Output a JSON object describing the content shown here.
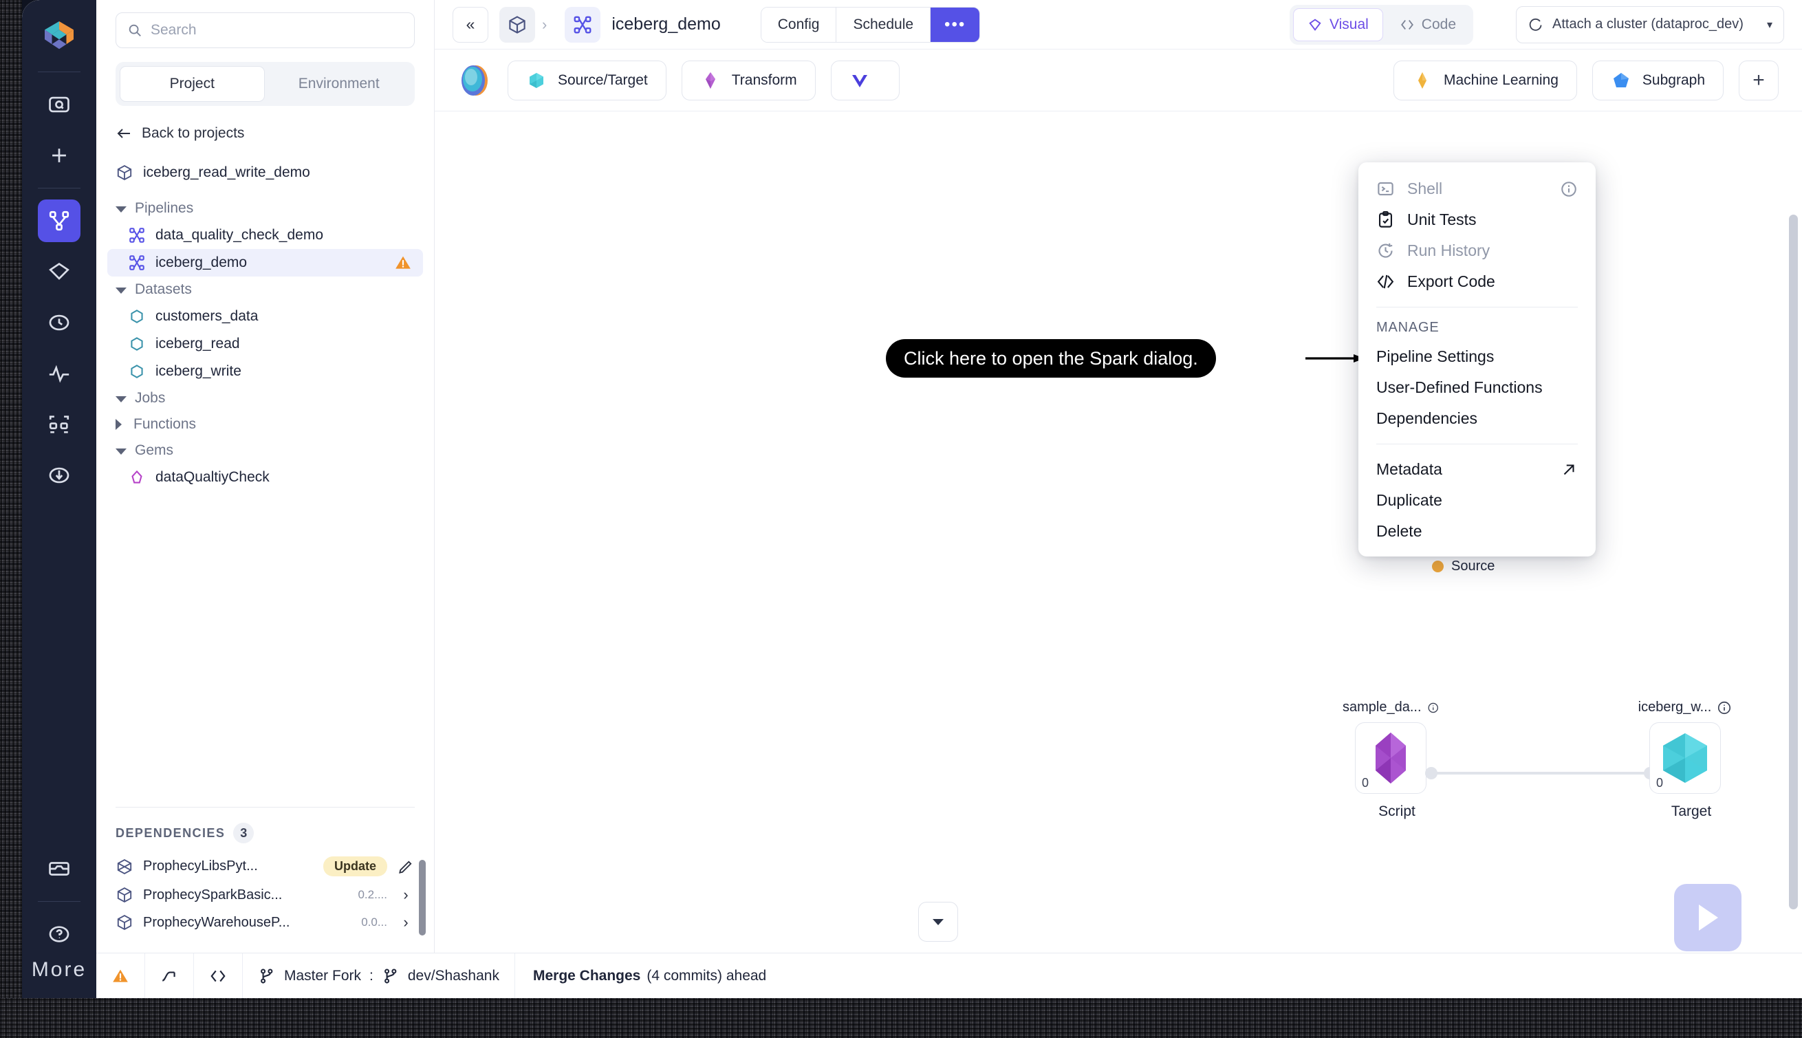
{
  "rail": {
    "logo": "prophecy-logo",
    "items": [
      {
        "name": "search-folder-icon",
        "label": "Search"
      },
      {
        "name": "plus-icon",
        "label": "Create"
      },
      {
        "name": "pipeline-graph-icon",
        "label": "Pipelines",
        "active": true
      },
      {
        "name": "gem-diamond-icon",
        "label": "Gems"
      },
      {
        "name": "clock-history-icon",
        "label": "History"
      },
      {
        "name": "pulse-activity-icon",
        "label": "Monitoring"
      },
      {
        "name": "lineage-nodes-icon",
        "label": "Lineage"
      },
      {
        "name": "download-circle-icon",
        "label": "Deploy"
      }
    ],
    "bottom": [
      {
        "name": "storage-icon",
        "label": "Storage"
      },
      {
        "name": "help-question-icon",
        "label": "Help"
      },
      {
        "name": "more-dots-icon",
        "label": "More"
      }
    ]
  },
  "panel": {
    "search": {
      "placeholder": "Search"
    },
    "tabs": [
      {
        "label": "Project",
        "selected": true
      },
      {
        "label": "Environment",
        "selected": false
      }
    ],
    "back_label": "Back to projects",
    "project_name": "iceberg_read_write_demo",
    "tree": [
      {
        "type": "group",
        "label": "Pipelines",
        "expanded": true
      },
      {
        "type": "item",
        "label": "data_quality_check_demo",
        "icon": "pipeline-graph-icon",
        "selected": false
      },
      {
        "type": "item",
        "label": "iceberg_demo",
        "icon": "pipeline-graph-icon",
        "selected": true,
        "badge": "warning"
      },
      {
        "type": "group",
        "label": "Datasets",
        "expanded": true
      },
      {
        "type": "item",
        "label": "customers_data",
        "icon": "dataset-hexagon-icon",
        "selected": false
      },
      {
        "type": "item",
        "label": "iceberg_read",
        "icon": "dataset-hexagon-icon",
        "selected": false
      },
      {
        "type": "item",
        "label": "iceberg_write",
        "icon": "dataset-hexagon-icon",
        "selected": false
      },
      {
        "type": "group",
        "label": "Jobs",
        "expanded": true
      },
      {
        "type": "group",
        "label": "Functions",
        "expanded": false
      },
      {
        "type": "group",
        "label": "Gems",
        "expanded": true
      },
      {
        "type": "item",
        "label": "dataQualtiyCheck",
        "icon": "gem-pentagon-icon",
        "selected": false
      }
    ],
    "dependencies": {
      "title": "DEPENDENCIES",
      "count": "3",
      "rows": [
        {
          "name": "ProphecyLibsPyt...",
          "pill": "Update",
          "trailing": "edit-pencil-icon",
          "version": ""
        },
        {
          "name": "ProphecySparkBasic...",
          "version": "0.2....",
          "trailing": "chevron-right-icon",
          "pill": ""
        },
        {
          "name": "ProphecyWarehouseP...",
          "version": "0.0...",
          "trailing": "chevron-right-icon",
          "pill": ""
        }
      ]
    }
  },
  "topbar": {
    "collapse_label": "«",
    "breadcrumb_project_icon": "cube-icon",
    "breadcrumb_sep": "›",
    "breadcrumb_pipeline_icon": "pipeline-graph-icon",
    "title": "iceberg_demo",
    "config_label": "Config",
    "schedule_label": "Schedule",
    "more_label": "•••",
    "view_toggle": [
      {
        "label": "Visual",
        "icon": "gem-diamond-icon",
        "selected": true
      },
      {
        "label": "Code",
        "icon": "code-brackets-icon",
        "selected": false
      }
    ],
    "cluster": {
      "label": "Attach a cluster (dataproc_dev)",
      "icon": "spinner-icon",
      "caret": "▾"
    }
  },
  "gembar": {
    "orb": "prophecy-orb-icon",
    "buttons": [
      {
        "label": "Source/Target",
        "icon": "hexagon-teal-icon"
      },
      {
        "label": "Transform",
        "icon": "diamond-purple-icon"
      },
      {
        "label": "",
        "icon": "chevron-indigo-icon"
      },
      {
        "label": "Machine Learning",
        "icon": "diamond-gold-icon"
      },
      {
        "label": "Subgraph",
        "icon": "pentagon-blue-icon"
      }
    ],
    "add_label": "+"
  },
  "menu": {
    "items": [
      {
        "label": "Shell",
        "icon": "terminal-icon",
        "disabled": true,
        "trailing": "info-icon"
      },
      {
        "label": "Unit Tests",
        "icon": "clipboard-check-icon",
        "disabled": false,
        "trailing": ""
      },
      {
        "label": "Run History",
        "icon": "clock-rotate-icon",
        "disabled": true,
        "trailing": ""
      },
      {
        "label": "Export Code",
        "icon": "code-brackets-icon",
        "disabled": false,
        "trailing": ""
      }
    ],
    "section_label": "MANAGE",
    "manage_items": [
      {
        "label": "Pipeline Settings",
        "trailing": ""
      },
      {
        "label": "User-Defined Functions",
        "trailing": ""
      },
      {
        "label": "Dependencies",
        "trailing": ""
      }
    ],
    "footer_items": [
      {
        "label": "Metadata",
        "trailing": "external-link-icon"
      },
      {
        "label": "Duplicate",
        "trailing": ""
      },
      {
        "label": "Delete",
        "trailing": ""
      }
    ]
  },
  "callout": {
    "text": "Click here to open the Spark dialog."
  },
  "canvas": {
    "legend": {
      "label": "Source",
      "color": "#f0a83c"
    },
    "nodes": [
      {
        "title": "sample_da...",
        "caption": "Script",
        "index": "0",
        "shape": "diamond-purple-icon",
        "info": "info-icon"
      },
      {
        "title": "iceberg_w...",
        "caption": "Target",
        "index": "0",
        "shape": "hexagon-teal-icon",
        "info": "info-icon"
      }
    ],
    "dropdown_caret": "▾",
    "run_icon": "play-icon"
  },
  "status": {
    "warning_icon": "warning-triangle-icon",
    "metrics_icon": "trend-arrow-icon",
    "code_icon": "code-brackets-icon",
    "base_branch": "Master Fork",
    "separator": ":",
    "current_branch": "dev/Shashank",
    "merge_label": "Merge Changes",
    "merge_detail": "(4 commits) ahead"
  }
}
